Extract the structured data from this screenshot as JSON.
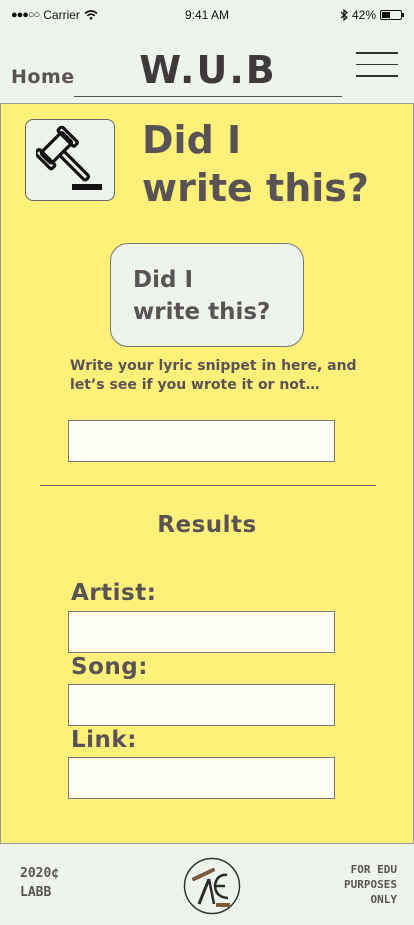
{
  "status_bar": {
    "signal": "●●●○○",
    "carrier": "Carrier",
    "time": "9:41 AM",
    "battery_percent": "42%",
    "battery_level": 0.42
  },
  "header": {
    "home_label": "Home",
    "app_title": "W.U.B",
    "menu_icon": "hamburger-icon"
  },
  "hero": {
    "icon": "gavel-icon",
    "title_line1": "Did I",
    "title_line2": "write this?"
  },
  "card": {
    "line1": "Did I",
    "line2": "write this?"
  },
  "lyric": {
    "instructions": "Write your lyric snippet in here, and let’s see if you wrote it or not…",
    "input_value": ""
  },
  "results": {
    "heading": "Results",
    "artist_label": "Artist:",
    "artist_value": "",
    "song_label": "Song:",
    "song_value": "",
    "link_label": "Link:",
    "link_value": ""
  },
  "footer": {
    "left_line1": "2020¢",
    "left_line2": "LABB",
    "logo_icon": "ae-logo-icon",
    "right_line1": "FOR EDU",
    "right_line2": "PURPOSES",
    "right_line3": "ONLY"
  },
  "colors": {
    "background": "#fff07a",
    "panel": "#eef4ec",
    "text": "#5a5355"
  }
}
